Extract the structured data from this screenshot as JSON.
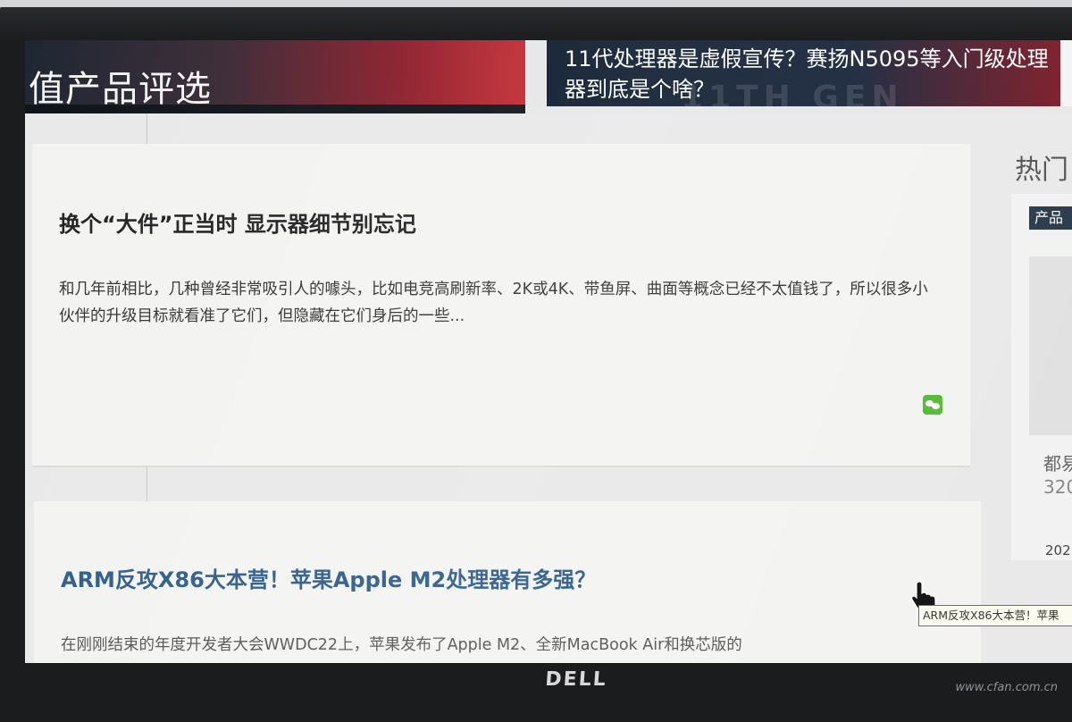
{
  "banner": {
    "section_title": "值产品评选",
    "headline": "11代处理器是虚假宣传？赛扬N5095等入门级处理器到底是个啥？",
    "deco_text": "11TH GEN"
  },
  "articles": [
    {
      "title": "换个“大件”正当时 显示器细节别忘记",
      "summary": "和几年前相比，几种曾经非常吸引人的噱头，比如电竞高刷新率、2K或4K、带鱼屏、曲面等概念已经不太值钱了，所以很多小伙伴的升级目标就看准了它们，但隐藏在它们身后的一些..."
    },
    {
      "title": "ARM反攻X86大本营！苹果Apple M2处理器有多强？",
      "summary": "在刚刚结束的年度开发者大会WWDC22上，苹果发布了Apple M2、全新MacBook Air和换芯版的"
    }
  ],
  "sidebar": {
    "title": "热门",
    "tag": "产品",
    "text_line1": "都易",
    "text_line2": "320",
    "date": "202"
  },
  "tooltip": "ARM反攻X86大本营！苹果",
  "monitor": {
    "brand": "DELL"
  },
  "watermark": "www.cfan.com.cn",
  "colors": {
    "accent_blue": "#2e5c8a",
    "wechat_green": "#53b934",
    "banner_red": "#c22a32"
  }
}
